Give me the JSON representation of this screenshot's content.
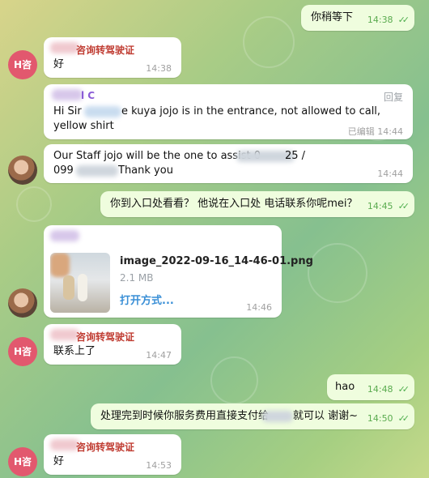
{
  "colors": {
    "outgoing_bubble": "#effdde",
    "incoming_bubble": "#ffffff",
    "sender_red": "#c03d33",
    "sender_purple": "#8a5bd6",
    "link_blue": "#3a8fd6",
    "avatar_red": "#e2586e"
  },
  "messages": [
    {
      "id": "m1",
      "dir": "out",
      "text": "你稍等下",
      "time": "14:38"
    },
    {
      "id": "m2",
      "dir": "in",
      "sender": "咨询转驾驶证",
      "avatar": "H咨",
      "text": "好",
      "time": "14:38"
    },
    {
      "id": "m3",
      "dir": "in",
      "sender": "l C",
      "reply_label": "回复",
      "line1": "Hi Sir",
      "line1b": "e kuya jojo is in the entrance, not allowed to call,",
      "line2": "yellow shirt",
      "edited": "已编辑",
      "time": "14:44"
    },
    {
      "id": "m4",
      "dir": "in",
      "line1a": "Our Staff jojo will be the one to assist 0",
      "line1b": "25 /",
      "line2a": "099",
      "line2b": "Thank you",
      "time": "14:44"
    },
    {
      "id": "m5",
      "dir": "out",
      "text": "你到入口处看看？ 他说在入口处 电话联系你呢mei？",
      "time": "14:45"
    },
    {
      "id": "m6",
      "dir": "in",
      "type": "file",
      "filename": "image_2022-09-16_14-46-01.png",
      "filesize": "2.1 MB",
      "open_with": "打开方式...",
      "time": "14:46"
    },
    {
      "id": "m7",
      "dir": "in",
      "sender": "咨询转驾驶证",
      "avatar": "H咨",
      "text": "联系上了",
      "time": "14:47"
    },
    {
      "id": "m8",
      "dir": "out",
      "text": "hao",
      "time": "14:48"
    },
    {
      "id": "m9",
      "dir": "out",
      "text_a": "处理完到时候你服务费用直接支付给",
      "text_b": "就可以 谢谢~",
      "time": "14:50"
    },
    {
      "id": "m10",
      "dir": "in",
      "sender": "咨询转驾驶证",
      "avatar": "H咨",
      "text": "好",
      "time": "14:53"
    }
  ],
  "icons": {
    "read_receipt": "double-check-icon"
  }
}
